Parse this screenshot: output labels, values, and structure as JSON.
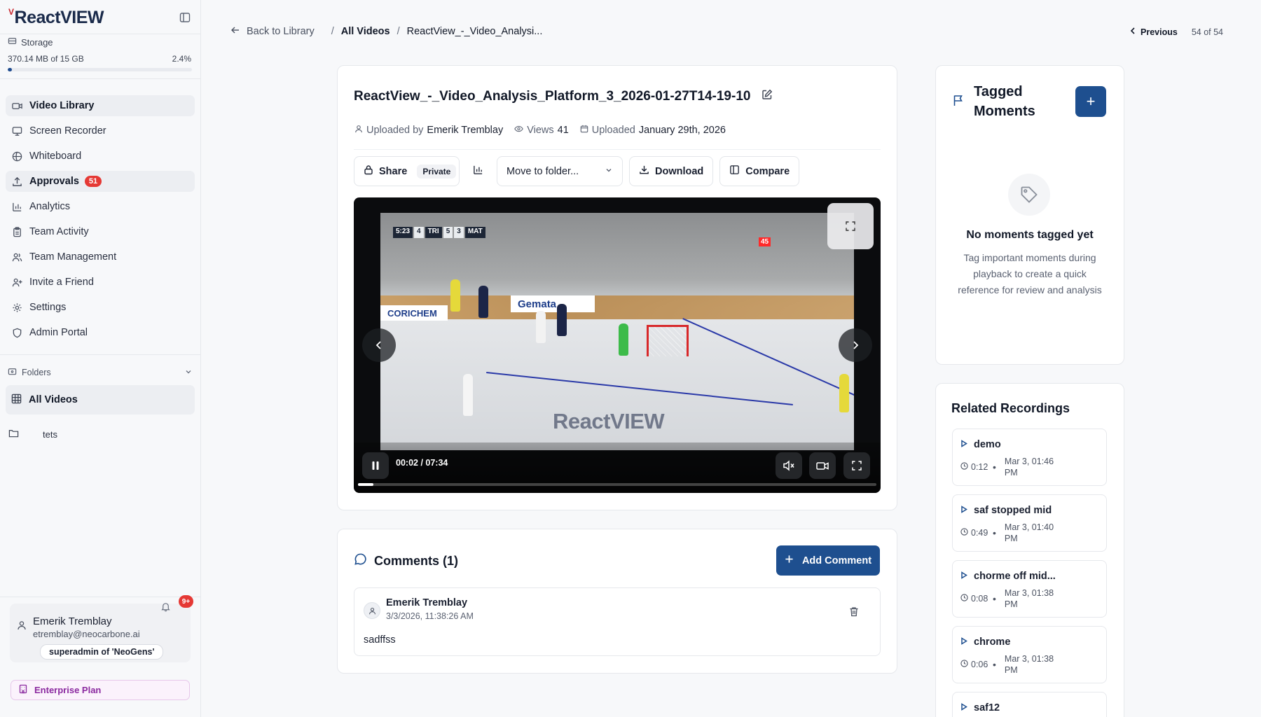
{
  "app": {
    "logo": "ReactVIEW",
    "logo_mark": "V"
  },
  "storage": {
    "label": "Storage",
    "used": "370.14 MB of 15 GB",
    "percent_label": "2.4%",
    "fraction": 0.024
  },
  "nav": {
    "items": [
      {
        "label": "Video Library",
        "icon": "video-icon"
      },
      {
        "label": "Screen Recorder",
        "icon": "monitor-icon"
      },
      {
        "label": "Whiteboard",
        "icon": "palette-icon"
      },
      {
        "label": "Approvals",
        "icon": "upload-icon",
        "badge": "51"
      },
      {
        "label": "Analytics",
        "icon": "bar-chart-icon"
      },
      {
        "label": "Team Activity",
        "icon": "clipboard-icon"
      },
      {
        "label": "Team Management",
        "icon": "users-icon"
      },
      {
        "label": "Invite a Friend",
        "icon": "user-plus-icon"
      },
      {
        "label": "Settings",
        "icon": "gear-icon"
      },
      {
        "label": "Admin Portal",
        "icon": "shield-icon"
      }
    ]
  },
  "folders": {
    "label": "Folders",
    "all_videos": "All Videos",
    "items": [
      {
        "label": "tets"
      }
    ]
  },
  "user": {
    "name": "Emerik Tremblay",
    "email": "etremblay@neocarbone.ai",
    "role": "superadmin of 'NeoGens'",
    "notifications": "9+",
    "plan": "Enterprise Plan"
  },
  "breadcrumb": {
    "back": "Back to Library",
    "sep": "/",
    "section": "All Videos",
    "current": "ReactView_-_Video_Analysi..."
  },
  "pager": {
    "previous": "Previous",
    "count": "54 of 54"
  },
  "video": {
    "title": "ReactView_-_Video_Analysis_Platform_3_2026-01-27T14-19-10",
    "uploaded_by_label": "Uploaded by",
    "uploaded_by": "Emerik Tremblay",
    "views_label": "Views",
    "views": "41",
    "uploaded_label": "Uploaded",
    "uploaded_date": "January 29th, 2026",
    "time": "00:02 / 07:34",
    "progress_fraction": 0.0045,
    "watermark": "ReactVIEW",
    "scoreboard": [
      "5:23",
      "4",
      "TRI",
      "5",
      "3",
      "MAT"
    ],
    "shot_clock": "45",
    "banners": [
      "CORICHEM",
      "Gemata"
    ]
  },
  "toolbar": {
    "share": "Share",
    "privacy": "Private",
    "move_placeholder": "Move to folder...",
    "download": "Download",
    "compare": "Compare"
  },
  "comments": {
    "title": "Comments (1)",
    "add_label": "Add Comment",
    "items": [
      {
        "author": "Emerik Tremblay",
        "date": "3/3/2026, 11:38:26 AM",
        "text": "sadffss"
      }
    ]
  },
  "tagged": {
    "title": "Tagged Moments",
    "add": "+",
    "empty_title": "No moments tagged yet",
    "empty_desc": "Tag important moments during playback to create a quick reference for review and analysis"
  },
  "related": {
    "title": "Related Recordings",
    "items": [
      {
        "name": "demo",
        "duration": "0:12",
        "date": "Mar 3, 01:46 PM"
      },
      {
        "name": "saf stopped mid",
        "duration": "0:49",
        "date": "Mar 3, 01:40 PM"
      },
      {
        "name": "chorme off mid...",
        "duration": "0:08",
        "date": "Mar 3, 01:38 PM"
      },
      {
        "name": "chrome",
        "duration": "0:06",
        "date": "Mar 3, 01:38 PM"
      },
      {
        "name": "saf12",
        "duration": "",
        "date": ""
      }
    ]
  },
  "colors": {
    "primary": "#1e4f8f",
    "badge": "#e53935",
    "plan": "#8b2aa0"
  }
}
